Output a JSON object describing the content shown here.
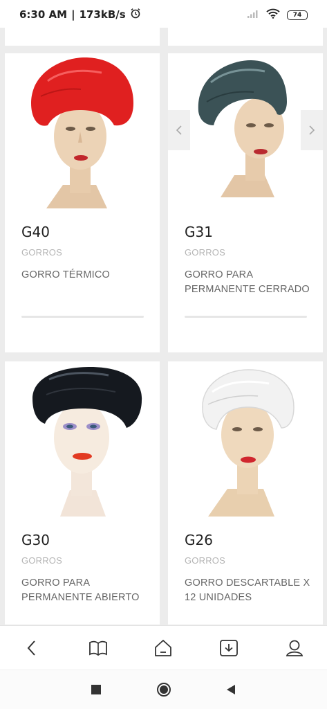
{
  "status_bar": {
    "time": "6:30 AM",
    "speed": "173kB/s",
    "battery": "74"
  },
  "products": [
    {
      "code": "G40",
      "category": "GORROS",
      "description": "GORRO TÉRMICO",
      "cap_color": "#e02020"
    },
    {
      "code": "G31",
      "category": "GORROS",
      "description": "GORRO PARA PERMANENTE CERRADO",
      "cap_color": "#3b5256"
    },
    {
      "code": "G30",
      "category": "GORROS",
      "description": "GORRO PARA PERMANENTE ABIERTO",
      "cap_color": "#15191f"
    },
    {
      "code": "G26",
      "category": "GORROS",
      "description": "GORRO DESCARTABLE X 12 UNIDADES",
      "cap_color": "#f2f2f2"
    }
  ],
  "toolbar": {
    "items": [
      "back-icon",
      "book-icon",
      "home-icon",
      "download-icon",
      "profile-icon"
    ]
  },
  "navbar": {
    "items": [
      "recents-square-icon",
      "home-circle-icon",
      "back-triangle-icon"
    ]
  }
}
